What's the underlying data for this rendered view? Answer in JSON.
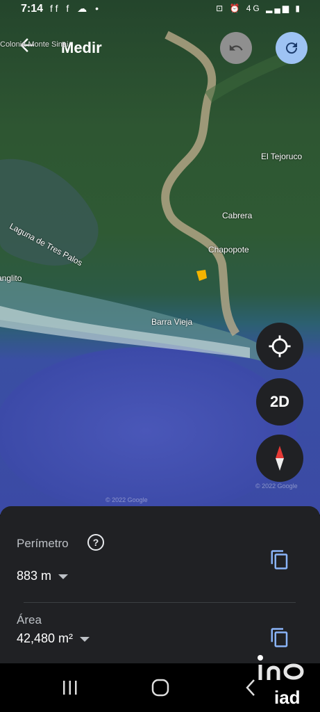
{
  "status_bar": {
    "time": "7:14",
    "notifications": "ff f ☁ •",
    "system": "⊡ ⏰ 4G ▂▄▆ ▮"
  },
  "top_bar": {
    "title": "Medir",
    "back_icon": "arrow-left-icon",
    "undo_icon": "undo-icon",
    "redo_icon": "redo-icon"
  },
  "map": {
    "places": [
      "Colonia Monte Sinai",
      "El Tejoruco",
      "Laguna de Tres Palos",
      "Cabrera",
      "Chapopote",
      "Tanglito",
      "Barra Vieja"
    ],
    "copyright_1": "© 2022 Google",
    "copyright_2": "© 2022 Google"
  },
  "fabs": {
    "locate_icon": "crosshair-icon",
    "view_toggle": "2D",
    "compass_icon": "compass-icon"
  },
  "measure_panel": {
    "perimeter_label": "Perímetro",
    "perimeter_value": "883 m",
    "area_label": "Área",
    "area_value": "42,480 m²"
  },
  "nav_bar": {
    "recents_icon": "recents-icon",
    "home_icon": "home-icon",
    "back_icon": "back-chevron-icon"
  },
  "watermark": {
    "brand": "iad"
  }
}
